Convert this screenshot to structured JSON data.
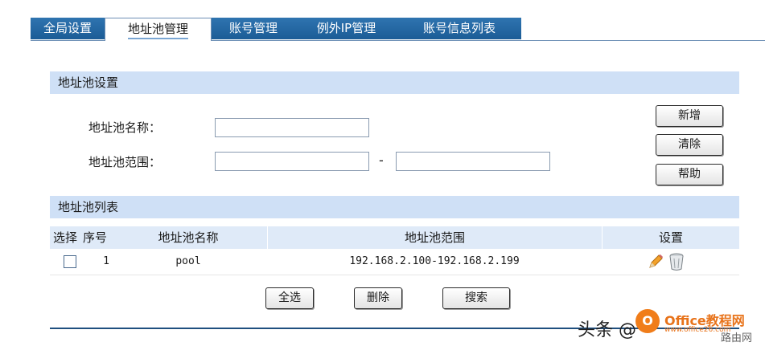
{
  "tabs": [
    {
      "label": "全局设置",
      "active": false
    },
    {
      "label": "地址池管理",
      "active": true
    },
    {
      "label": "账号管理",
      "active": false
    },
    {
      "label": "例外IP管理",
      "active": false
    },
    {
      "label": "账号信息列表",
      "active": false
    }
  ],
  "pool_settings": {
    "header": "地址池设置",
    "name_label": "地址池名称：",
    "name_value": "",
    "range_label": "地址池范围：",
    "range_start": "",
    "range_sep": "-",
    "range_end": "",
    "buttons": {
      "add": "新增",
      "clear": "清除",
      "help": "帮助"
    }
  },
  "pool_list": {
    "header": "地址池列表",
    "columns": {
      "select": "选择",
      "index": "序号",
      "name": "地址池名称",
      "range": "地址池范围",
      "settings": "设置"
    },
    "rows": [
      {
        "index": "1",
        "name": "pool",
        "range": "192.168.2.100-192.168.2.199",
        "checked": false
      }
    ],
    "buttons": {
      "select_all": "全选",
      "delete": "删除",
      "search": "搜索"
    }
  },
  "watermark": {
    "text": "头条 @",
    "logo": "O",
    "brand": "Office教程网",
    "url": "www.office26.com",
    "corner": "路由网"
  },
  "colors": {
    "tab_bg": "#1b5c96",
    "section_header_bg": "#cfe0f6",
    "table_header_bg": "#dfeaf8",
    "watermark_orange": "#f07d1a"
  }
}
